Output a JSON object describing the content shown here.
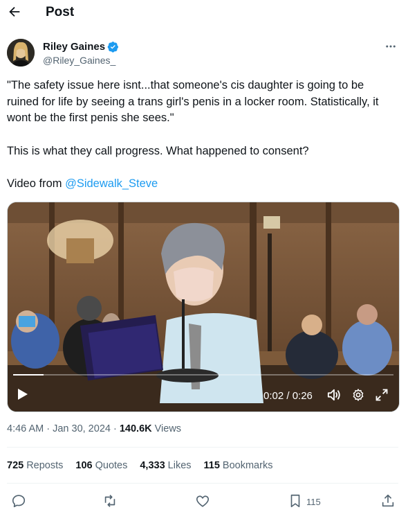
{
  "header": {
    "title": "Post"
  },
  "author": {
    "name": "Riley Gaines",
    "handle": "@Riley_Gaines_"
  },
  "post": {
    "line1": "\"The safety issue here isnt...that someone's cis daughter is going to be ruined for life by seeing a trans girl's penis in a locker room. Statistically, it wont be the first penis she sees.\"",
    "line2": "This is what they call progress. What happened to consent?",
    "video_prefix": "Video from ",
    "video_mention": "@Sidewalk_Steve"
  },
  "video": {
    "time": "0:02 / 0:26",
    "progress": 0.08
  },
  "meta": {
    "time": "4:46 AM",
    "dot1": " · ",
    "date": "Jan 30, 2024",
    "dot2": " · ",
    "views": "140.6K",
    "views_label": " Views"
  },
  "stats": {
    "reposts": "725",
    "reposts_label": "Reposts",
    "quotes": "106",
    "quotes_label": "Quotes",
    "likes": "4,333",
    "likes_label": "Likes",
    "bookmarks": "115",
    "bookmarks_label": "Bookmarks"
  },
  "actions": {
    "bookmark_count": "115"
  },
  "colors": {
    "accent": "#1d9bf0",
    "text": "#0f1419",
    "muted": "#536471"
  }
}
